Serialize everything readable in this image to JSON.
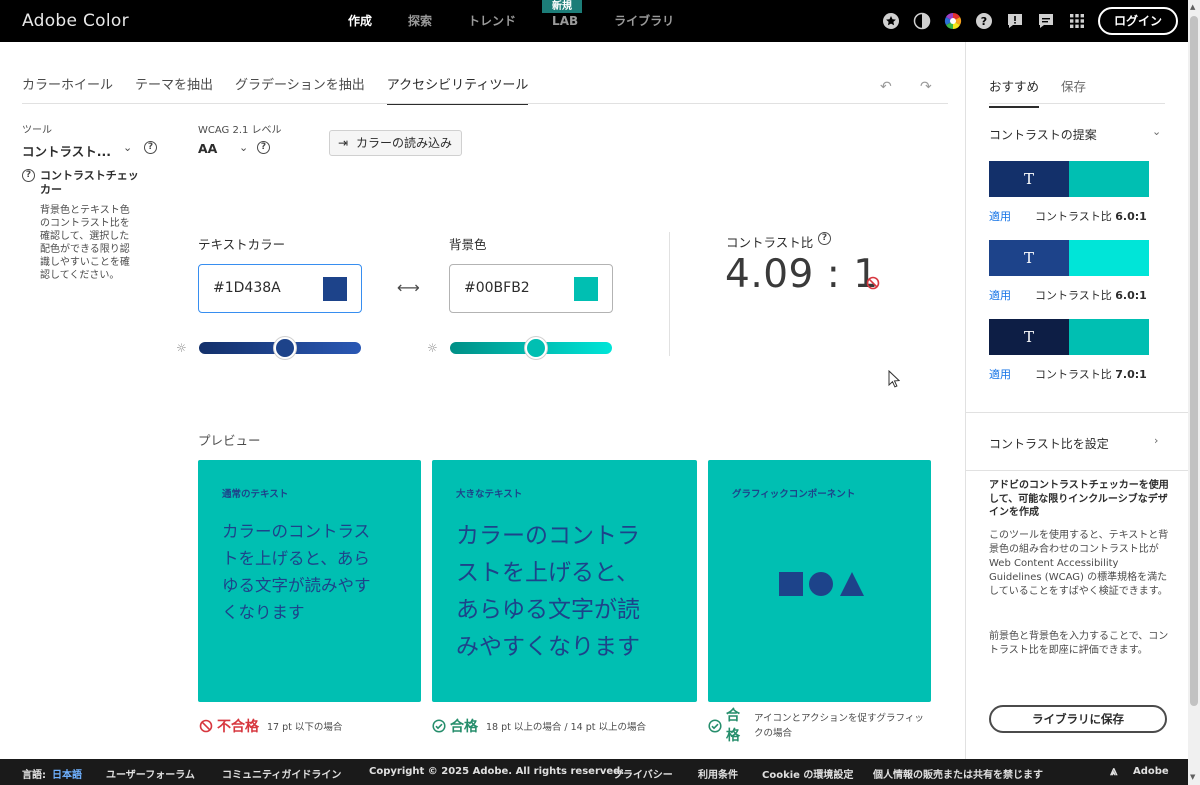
{
  "header": {
    "brand": "Adobe Color",
    "nav": [
      "作成",
      "探索",
      "トレンド",
      "LAB",
      "ライブラリ"
    ],
    "lab_badge": "新規",
    "login": "ログイン",
    "icons": [
      "star-badge-icon",
      "contrast-mode-icon",
      "color-wheel-icon",
      "help-icon",
      "feedback-icon",
      "chat-icon",
      "apps-grid-icon"
    ]
  },
  "tabs": [
    "カラーホイール",
    "テーマを抽出",
    "グラデーションを抽出",
    "アクセシビリティツール"
  ],
  "tool": {
    "label": "ツール",
    "value": "コントラスト...",
    "section_title": "コントラストチェッカー",
    "description": "背景色とテキスト色のコントラスト比を確認して、選択した配色ができる限り認識しやすいことを確認してください。"
  },
  "wcag": {
    "label": "WCAG 2.1 レベル",
    "value": "AA"
  },
  "import_button": "カラーの読み込み",
  "text_color": {
    "label": "テキストカラー",
    "hex": "#1D438A",
    "swatch": "#1D438A"
  },
  "bg_color": {
    "label": "背景色",
    "hex": "#00BFB2",
    "swatch": "#00BFB2"
  },
  "contrast": {
    "label": "コントラスト比",
    "value": "4.09 : 1"
  },
  "preview": {
    "label": "プレビュー",
    "cards": [
      {
        "title": "通常のテキスト",
        "text": "カラーのコントラストを上げると、あらゆる文字が読みやすくなります"
      },
      {
        "title": "大きなテキスト",
        "text": "カラーのコントラストを上げると、あらゆる文字が読みやすくなります"
      },
      {
        "title": "グラフィックコンポーネント"
      }
    ],
    "results": [
      {
        "word": "不合格",
        "note": "17 pt 以下の場合",
        "color": "#d7373f"
      },
      {
        "word": "合格",
        "note": "18 pt 以上の場合 / 14 pt 以上の場合",
        "color": "#268e6c"
      },
      {
        "word": "合格",
        "note": "アイコンとアクションを促すグラフィックの場合",
        "color": "#268e6c"
      }
    ]
  },
  "right_panel": {
    "tabs": [
      "おすすめ",
      "保存"
    ],
    "suggestions_title": "コントラストの提案",
    "suggestions": [
      {
        "left": "#13306A",
        "right": "#00BFB2",
        "apply": "適用",
        "ratio_label": "コントラスト比",
        "ratio": "6.0:1"
      },
      {
        "left": "#1D438A",
        "right": "#00E5D8",
        "apply": "適用",
        "ratio_label": "コントラスト比",
        "ratio": "6.0:1"
      },
      {
        "left": "#0D1E45",
        "right": "#00BFB2",
        "apply": "適用",
        "ratio_label": "コントラスト比",
        "ratio": "7.0:1"
      }
    ],
    "suggestion_letter": "T",
    "set_ratio": "コントラスト比を設定",
    "promo_title": "アドビのコントラストチェッカーを使用して、可能な限りインクルーシブなデザインを作成",
    "promo_p1": "このツールを使用すると、テキストと背景色の組み合わせのコントラスト比が Web Content Accessibility Guidelines (WCAG) の標準規格を満たしていることをすばやく検証できます。",
    "promo_p2": "前景色と背景色を入力することで、コントラスト比を即座に評価できます。",
    "save_button": "ライブラリに保存"
  },
  "footer": {
    "lang_label": "言語:",
    "lang_value": "日本語",
    "links": [
      "ユーザーフォーラム",
      "コミュニティガイドライン",
      "Copyright © 2025 Adobe. All rights reserved.",
      "プライバシー",
      "利用条件",
      "Cookie の環境設定",
      "個人情報の販売または共有を禁じます"
    ],
    "adobe": "Adobe"
  }
}
